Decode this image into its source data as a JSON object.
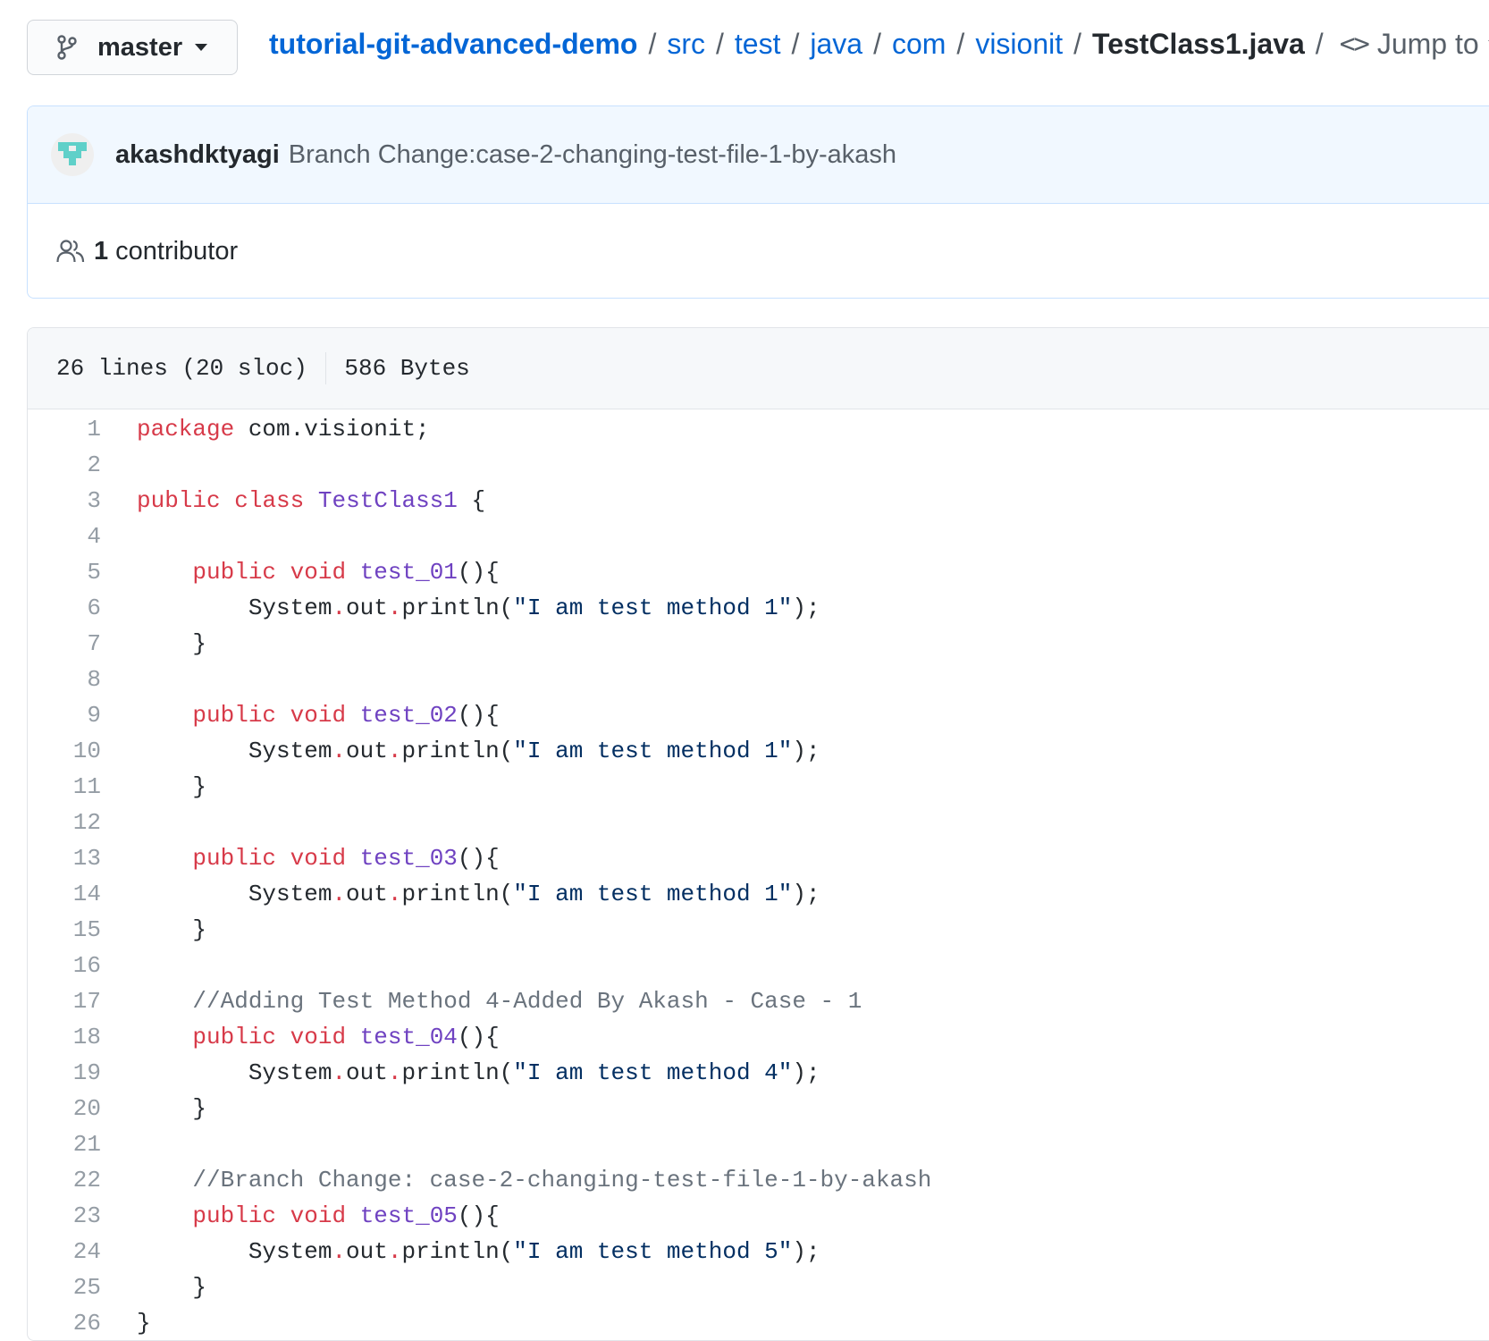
{
  "branch": {
    "name": "master"
  },
  "breadcrumb": {
    "repo": "tutorial-git-advanced-demo",
    "parts": [
      "src",
      "test",
      "java",
      "com",
      "visionit"
    ],
    "file": "TestClass1.java",
    "jump_to": "Jump to"
  },
  "commit": {
    "author": "akashdktyagi",
    "message": "Branch Change:case-2-changing-test-file-1-by-akash"
  },
  "contributors": {
    "count": "1",
    "label": "contributor"
  },
  "file_info": {
    "lines": "26 lines (20 sloc)",
    "size": "586 Bytes"
  },
  "code_lines": [
    [
      {
        "t": "package",
        "c": "kw"
      },
      {
        "t": " com.visionit;"
      }
    ],
    [],
    [
      {
        "t": "public",
        "c": "kw"
      },
      {
        "t": " "
      },
      {
        "t": "class",
        "c": "kw"
      },
      {
        "t": " "
      },
      {
        "t": "TestClass1",
        "c": "ent"
      },
      {
        "t": " {"
      }
    ],
    [],
    [
      {
        "t": "    "
      },
      {
        "t": "public",
        "c": "kw"
      },
      {
        "t": " "
      },
      {
        "t": "void",
        "c": "kw"
      },
      {
        "t": " "
      },
      {
        "t": "test_01",
        "c": "ent"
      },
      {
        "t": "(){"
      }
    ],
    [
      {
        "t": "        System"
      },
      {
        "t": ".",
        "c": "kw"
      },
      {
        "t": "out"
      },
      {
        "t": ".",
        "c": "kw"
      },
      {
        "t": "println("
      },
      {
        "t": "\"I am test method 1\"",
        "c": "str"
      },
      {
        "t": ");"
      }
    ],
    [
      {
        "t": "    }"
      }
    ],
    [],
    [
      {
        "t": "    "
      },
      {
        "t": "public",
        "c": "kw"
      },
      {
        "t": " "
      },
      {
        "t": "void",
        "c": "kw"
      },
      {
        "t": " "
      },
      {
        "t": "test_02",
        "c": "ent"
      },
      {
        "t": "(){"
      }
    ],
    [
      {
        "t": "        System"
      },
      {
        "t": ".",
        "c": "kw"
      },
      {
        "t": "out"
      },
      {
        "t": ".",
        "c": "kw"
      },
      {
        "t": "println("
      },
      {
        "t": "\"I am test method 1\"",
        "c": "str"
      },
      {
        "t": ");"
      }
    ],
    [
      {
        "t": "    }"
      }
    ],
    [],
    [
      {
        "t": "    "
      },
      {
        "t": "public",
        "c": "kw"
      },
      {
        "t": " "
      },
      {
        "t": "void",
        "c": "kw"
      },
      {
        "t": " "
      },
      {
        "t": "test_03",
        "c": "ent"
      },
      {
        "t": "(){"
      }
    ],
    [
      {
        "t": "        System"
      },
      {
        "t": ".",
        "c": "kw"
      },
      {
        "t": "out"
      },
      {
        "t": ".",
        "c": "kw"
      },
      {
        "t": "println("
      },
      {
        "t": "\"I am test method 1\"",
        "c": "str"
      },
      {
        "t": ");"
      }
    ],
    [
      {
        "t": "    }"
      }
    ],
    [],
    [
      {
        "t": "    "
      },
      {
        "t": "//Adding Test Method 4-Added By Akash - Case - 1",
        "c": "com"
      }
    ],
    [
      {
        "t": "    "
      },
      {
        "t": "public",
        "c": "kw"
      },
      {
        "t": " "
      },
      {
        "t": "void",
        "c": "kw"
      },
      {
        "t": " "
      },
      {
        "t": "test_04",
        "c": "ent"
      },
      {
        "t": "(){"
      }
    ],
    [
      {
        "t": "        System"
      },
      {
        "t": ".",
        "c": "kw"
      },
      {
        "t": "out"
      },
      {
        "t": ".",
        "c": "kw"
      },
      {
        "t": "println("
      },
      {
        "t": "\"I am test method 4\"",
        "c": "str"
      },
      {
        "t": ");"
      }
    ],
    [
      {
        "t": "    }"
      }
    ],
    [],
    [
      {
        "t": "    "
      },
      {
        "t": "//Branch Change: case-2-changing-test-file-1-by-akash",
        "c": "com"
      }
    ],
    [
      {
        "t": "    "
      },
      {
        "t": "public",
        "c": "kw"
      },
      {
        "t": " "
      },
      {
        "t": "void",
        "c": "kw"
      },
      {
        "t": " "
      },
      {
        "t": "test_05",
        "c": "ent"
      },
      {
        "t": "(){"
      }
    ],
    [
      {
        "t": "        System"
      },
      {
        "t": ".",
        "c": "kw"
      },
      {
        "t": "out"
      },
      {
        "t": ".",
        "c": "kw"
      },
      {
        "t": "println("
      },
      {
        "t": "\"I am test method 5\"",
        "c": "str"
      },
      {
        "t": ");"
      }
    ],
    [
      {
        "t": "    }"
      }
    ],
    [
      {
        "t": "}"
      }
    ]
  ],
  "icons": {
    "branch": "git-branch-icon",
    "code": "code-icon",
    "people": "people-icon",
    "avatar": "identicon-avatar"
  },
  "colors": {
    "link": "#0366d6",
    "keyword": "#d73a49",
    "entity": "#6f42c1",
    "string": "#032f62",
    "comment": "#6a737d",
    "commit_bg": "#f1f8ff",
    "avatar": "#5fd0c9"
  }
}
